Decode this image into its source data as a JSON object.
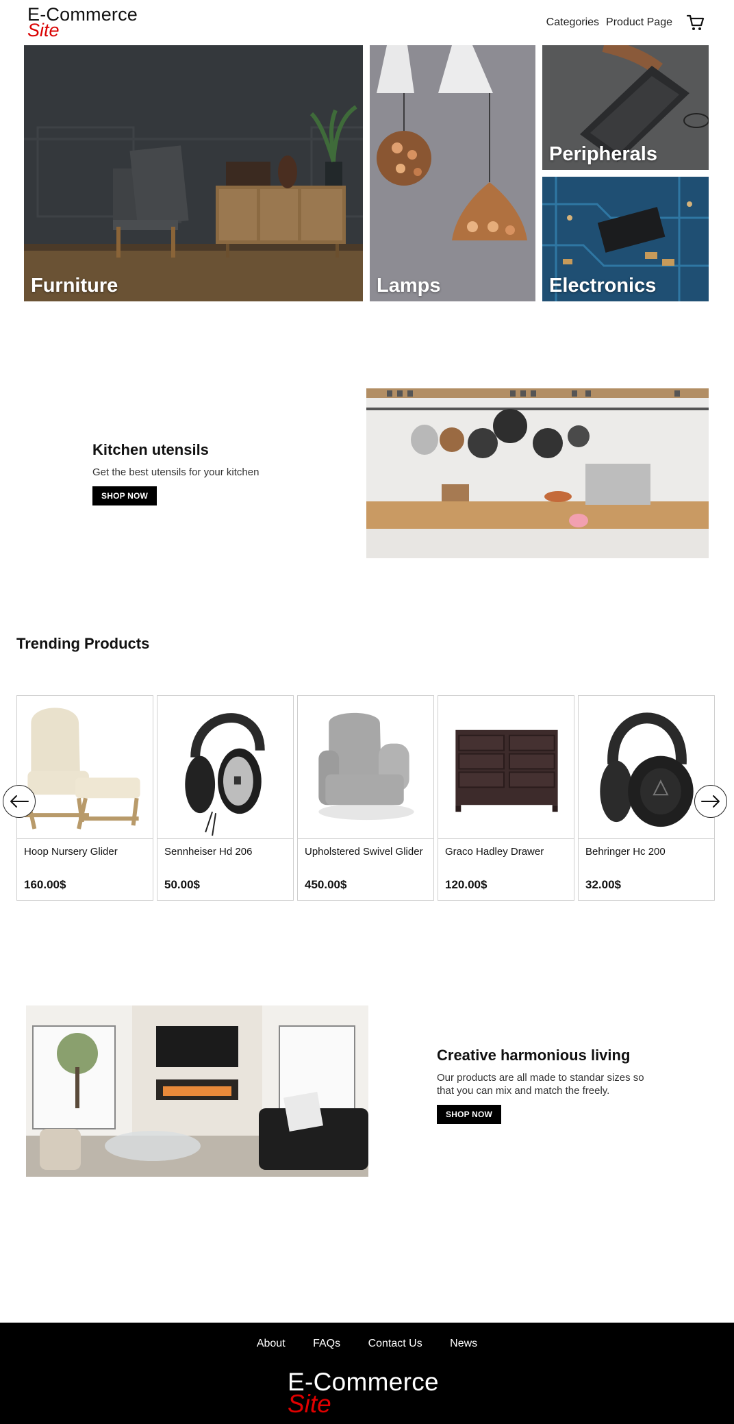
{
  "header": {
    "logo_line1": "E-Commerce",
    "logo_line2": "Site",
    "nav": [
      "Categories",
      "Product Page"
    ],
    "cart_icon": "shopping-cart-icon"
  },
  "categories": [
    {
      "label": "Furniture"
    },
    {
      "label": "Lamps"
    },
    {
      "label": "Peripherals"
    },
    {
      "label": "Electronics"
    }
  ],
  "promo_kitchen": {
    "title": "Kitchen utensils",
    "subtitle": "Get the best utensils for your kitchen",
    "button": "SHOP NOW"
  },
  "trending": {
    "title": "Trending Products",
    "prev_icon": "arrow-left-icon",
    "next_icon": "arrow-right-icon",
    "products": [
      {
        "name": "Hoop Nursery Glider",
        "price": "160.00$"
      },
      {
        "name": "Sennheiser Hd 206",
        "price": "50.00$"
      },
      {
        "name": "Upholstered Swivel Glider",
        "price": "450.00$"
      },
      {
        "name": "Graco Hadley Drawer",
        "price": "120.00$"
      },
      {
        "name": "Behringer Hc 200",
        "price": "32.00$"
      }
    ]
  },
  "promo_living": {
    "title": "Creative harmonious living",
    "subtitle": "Our products are all made to standar sizes so that you can mix and match the freely.",
    "button": "SHOP NOW"
  },
  "footer": {
    "links": [
      "About",
      "FAQs",
      "Contact Us",
      "News"
    ],
    "logo_line1": "E-Commerce",
    "logo_line2": "Site"
  },
  "colors": {
    "accent_red": "#d90000",
    "footer_bg": "#000000",
    "button_bg": "#000000"
  }
}
